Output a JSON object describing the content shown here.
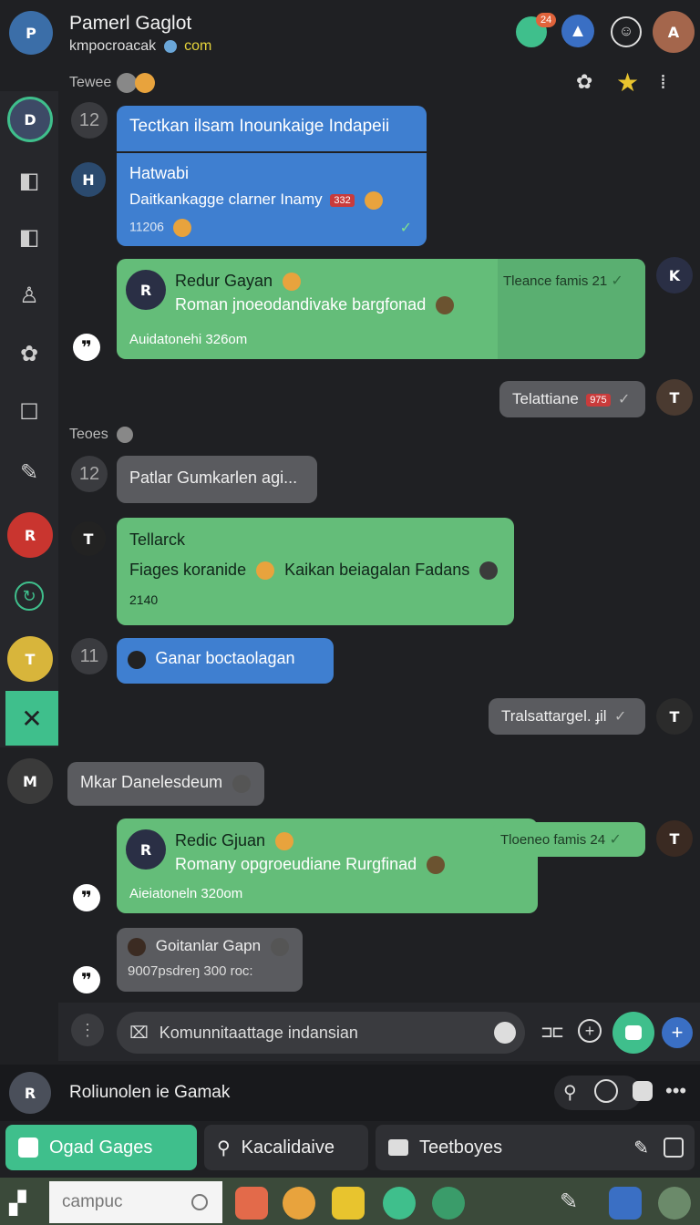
{
  "header": {
    "name": "Pamerl Gaglot",
    "status": "kmpocroacak",
    "status_link": "com",
    "notif_count": "24"
  },
  "sections": {
    "first": "Tewee",
    "second": "Teoes"
  },
  "messages": {
    "m1_count": "12",
    "m1_title": "Tectkan ilsam Inounkaige Indapeii",
    "m2_name": "Hatwabi",
    "m2_text": "Daitkankagge clarner Inamy",
    "m2_badge": "332",
    "m2_time": "11206",
    "m3_name": "Redur Gayan",
    "m3_text": "Roman jnoeodandivake bargfonad",
    "m3_sub": "Auidatonehi 326om",
    "m3_side": "Tleance famis 21",
    "m4_text": "Telattiane",
    "m4_badge": "975",
    "m5_count": "12",
    "m5_text": "Patlar Gumkarlen agi...",
    "m6_name": "Tellarck",
    "m6_text": "Fiages koranide",
    "m6_text2": "Kaikan beiagalan Fadans",
    "m6_time": "2140",
    "m7_count": "11",
    "m7_text": "Ganar boctaolagan",
    "m8_text": "Tralsattargel. ɟil",
    "m9_text": "Mkar Danelesdeum",
    "m10_name": "Redic Gjuan",
    "m10_text": "Romany opgroeudiane Rurgfinad",
    "m10_sub": "Aieiatoneln 320om",
    "m10_side": "Tloeneo famis 24",
    "m11_name": "Goitanlar Gapn",
    "m11_text": "9007psdreŋ 300 roc:"
  },
  "composer": {
    "placeholder": "Komunnitaattage indansian"
  },
  "footer_user": {
    "name": "Roliunolen ie Gamak"
  },
  "tabs": {
    "t1": "Ogad Gages",
    "t2": "Kacalidaive",
    "t3": "Teetboyes"
  },
  "taskbar": {
    "search": "campuc"
  },
  "colors": {
    "accent_green": "#3fbf8c",
    "bubble_blue": "#3f7fd0",
    "bubble_green": "#64bd79",
    "bg": "#1f2023"
  }
}
